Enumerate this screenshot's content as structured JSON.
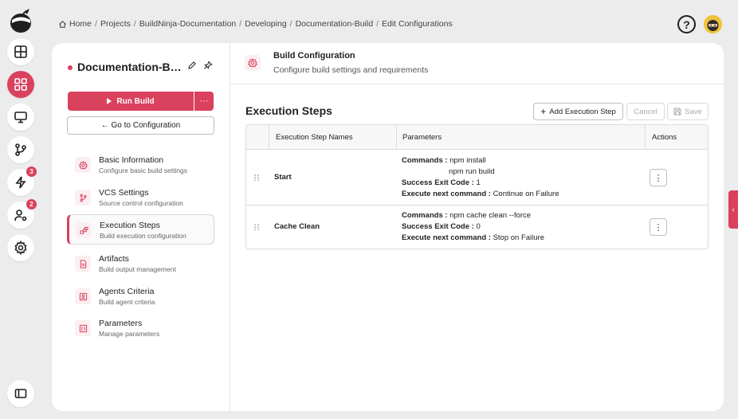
{
  "colors": {
    "accent": "#d9415d",
    "background": "#ececec",
    "card": "#ffffff"
  },
  "rail": {
    "items": [
      {
        "icon": "dashboard-icon"
      },
      {
        "icon": "apps-grid-icon",
        "active": true
      },
      {
        "icon": "monitor-icon"
      },
      {
        "icon": "git-branch-icon"
      },
      {
        "icon": "lightning-icon",
        "badge": "3"
      },
      {
        "icon": "user-settings-icon",
        "badge": "2"
      },
      {
        "icon": "gear-icon"
      },
      {
        "icon": "sidebar-toggle-icon"
      }
    ]
  },
  "breadcrumb": [
    "Home",
    "Projects",
    "BuildNinja-Documentation",
    "Developing",
    "Documentation-Build",
    "Edit Configurations"
  ],
  "help_label": "?",
  "project": {
    "title": "Documentation-Build"
  },
  "actions": {
    "run_build": "Run Build",
    "more": "···",
    "goto_config": "← Go to Configuration"
  },
  "nav": [
    {
      "title": "Basic Information",
      "sub": "Configure basic build settings",
      "icon": "gear-icon"
    },
    {
      "title": "VCS Settings",
      "sub": "Source control configuration",
      "icon": "git-branch-icon"
    },
    {
      "title": "Execution Steps",
      "sub": "Build execution configuration",
      "icon": "steps-icon",
      "active": true
    },
    {
      "title": "Artifacts",
      "sub": "Build output management",
      "icon": "file-icon"
    },
    {
      "title": "Agents Criteria",
      "sub": "Build agent criteria",
      "icon": "agent-icon"
    },
    {
      "title": "Parameters",
      "sub": "Manage parameters",
      "icon": "parameters-icon"
    }
  ],
  "header": {
    "title": "Build Configuration",
    "sub": "Configure build settings and requirements"
  },
  "section": {
    "title": "Execution Steps",
    "add_label": "Add Execution Step",
    "cancel_label": "Cancel",
    "save_label": "Save"
  },
  "table": {
    "columns": [
      "Execution Step Names",
      "Parameters",
      "Actions"
    ],
    "labels": {
      "commands": "Commands :",
      "exit_code": "Success Exit Code :",
      "next": "Execute next command :"
    },
    "rows": [
      {
        "name": "Start",
        "commands": [
          "npm install",
          "npm run build"
        ],
        "exit_code": "1",
        "next": "Continue on Failure"
      },
      {
        "name": "Cache Clean",
        "commands": [
          "npm cache clean --force"
        ],
        "exit_code": "0",
        "next": "Stop on Failure"
      }
    ],
    "action_label": "⋮"
  },
  "side_tab": "‹"
}
